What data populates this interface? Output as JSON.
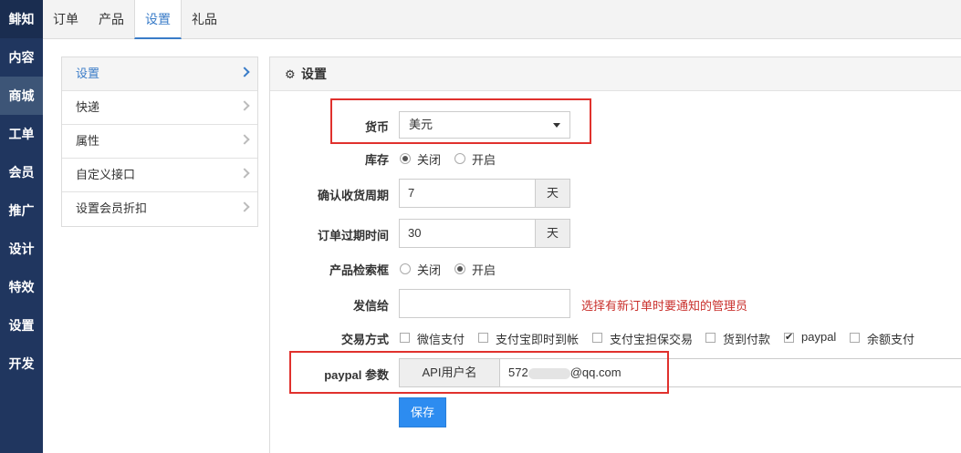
{
  "sidebar": {
    "logo": "鲱知",
    "items": [
      {
        "label": "内容"
      },
      {
        "label": "商城"
      },
      {
        "label": "工单"
      },
      {
        "label": "会员"
      },
      {
        "label": "推广"
      },
      {
        "label": "设计"
      },
      {
        "label": "特效"
      },
      {
        "label": "设置"
      },
      {
        "label": "开发"
      }
    ]
  },
  "topnav": {
    "tabs": [
      {
        "label": "订单"
      },
      {
        "label": "产品"
      },
      {
        "label": "设置"
      },
      {
        "label": "礼品"
      }
    ]
  },
  "submenu": {
    "items": [
      {
        "label": "设置"
      },
      {
        "label": "快递"
      },
      {
        "label": "属性"
      },
      {
        "label": "自定义接口"
      },
      {
        "label": "设置会员折扣"
      }
    ]
  },
  "panel": {
    "title": "设置",
    "currency": {
      "label": "货币",
      "value": "美元"
    },
    "stock": {
      "label": "库存",
      "off": "关闭",
      "on": "开启",
      "selected": "关闭"
    },
    "confirm_period": {
      "label": "确认收货周期",
      "value": "7",
      "unit": "天"
    },
    "order_expire": {
      "label": "订单过期时间",
      "value": "30",
      "unit": "天"
    },
    "search_box": {
      "label": "产品检索框",
      "off": "关闭",
      "on": "开启",
      "selected": "开启"
    },
    "notify": {
      "label": "发信给",
      "value": "",
      "hint": "选择有新订单时要通知的管理员"
    },
    "payment": {
      "label": "交易方式",
      "options": [
        {
          "label": "微信支付",
          "checked": false
        },
        {
          "label": "支付宝即时到帐",
          "checked": false
        },
        {
          "label": "支付宝担保交易",
          "checked": false
        },
        {
          "label": "货到付款",
          "checked": false
        },
        {
          "label": "paypal",
          "checked": true
        },
        {
          "label": "余额支付",
          "checked": false
        }
      ]
    },
    "paypal": {
      "label": "paypal 参数",
      "field_label": "API用户名",
      "value_prefix": "572",
      "value_suffix": "@qq.com"
    },
    "save_label": "保存"
  },
  "colors": {
    "sidebar": "#20365f",
    "accent": "#3a7cc8",
    "highlight_box": "#e0312d",
    "button": "#2d8cf0"
  }
}
